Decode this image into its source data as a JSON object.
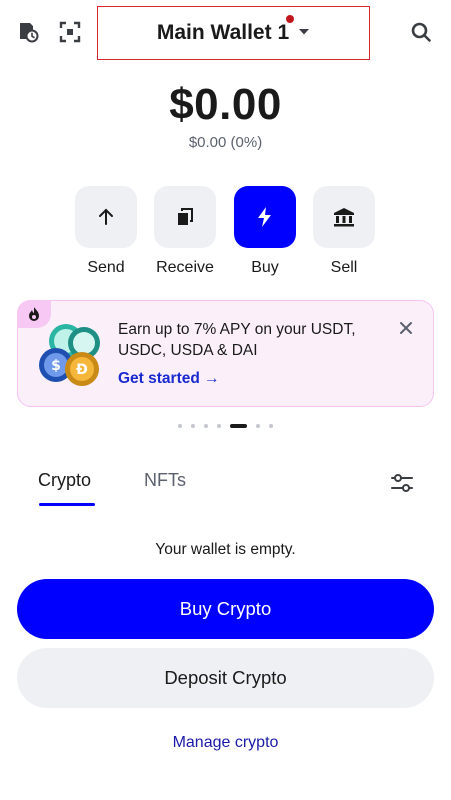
{
  "header": {
    "wallet_name": "Main Wallet 1"
  },
  "balance": {
    "amount": "$0.00",
    "change": "$0.00 (0%)"
  },
  "actions": [
    {
      "label": "Send"
    },
    {
      "label": "Receive"
    },
    {
      "label": "Buy"
    },
    {
      "label": "Sell"
    }
  ],
  "promo": {
    "text": "Earn up to 7% APY on your USDT, USDC, USDA & DAI",
    "link": "Get started →"
  },
  "carousel": {
    "count": 7,
    "active_index": 4
  },
  "tabs": [
    {
      "label": "Crypto",
      "active": true
    },
    {
      "label": "NFTs",
      "active": false
    }
  ],
  "empty_state": {
    "message": "Your wallet is empty.",
    "primary_button": "Buy Crypto",
    "secondary_button": "Deposit Crypto",
    "link": "Manage crypto"
  },
  "colors": {
    "primary": "#0000ff",
    "promo_bg": "#fbf0fa",
    "promo_border": "#f3c4f1",
    "notification_dot": "#c0161c",
    "link": "#1a2ad0"
  }
}
